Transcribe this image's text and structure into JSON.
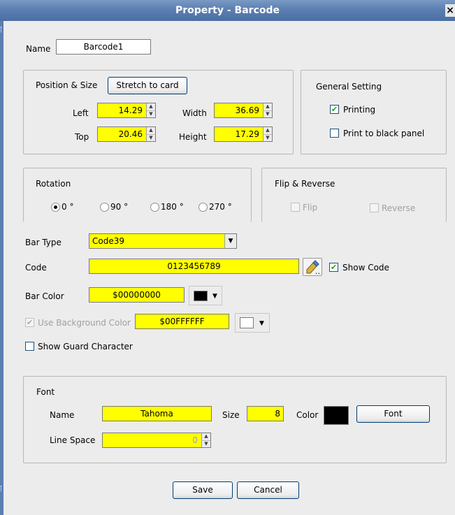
{
  "window": {
    "title": "Property - Barcode",
    "close_glyph": "×"
  },
  "name_field": {
    "label": "Name",
    "value": "Barcode1"
  },
  "position_size": {
    "group_label": "Position & Size",
    "stretch_button": "Stretch to card",
    "left": {
      "label": "Left",
      "value": "14.29"
    },
    "top": {
      "label": "Top",
      "value": "20.46"
    },
    "width": {
      "label": "Width",
      "value": "36.69"
    },
    "height": {
      "label": "Height",
      "value": "17.29"
    }
  },
  "general_setting": {
    "group_label": "General Setting",
    "printing": {
      "label": "Printing",
      "checked": true
    },
    "print_black": {
      "label": "Print to black panel",
      "checked": false
    }
  },
  "rotation": {
    "group_label": "Rotation",
    "options": [
      "0 °",
      "90 °",
      "180 °",
      "270 °"
    ],
    "selected": "0 °"
  },
  "flip_reverse": {
    "group_label": "Flip & Reverse",
    "flip": "Flip",
    "reverse": "Reverse"
  },
  "bar_type": {
    "label": "Bar Type",
    "value": "Code39"
  },
  "code": {
    "label": "Code",
    "value": "0123456789",
    "more_glyph": "..",
    "show_code": "Show Code"
  },
  "bar_color": {
    "label": "Bar Color",
    "value": "$00000000",
    "swatch": "#000000"
  },
  "background": {
    "label": "Use Background Color",
    "value": "$00FFFFFF",
    "swatch": "#ffffff"
  },
  "guard": {
    "label": "Show Guard Character"
  },
  "font": {
    "group_label": "Font",
    "name_label": "Name",
    "name_value": "Tahoma",
    "size_label": "Size",
    "size_value": "8",
    "color_label": "Color",
    "color_swatch": "#000000",
    "font_button": "Font",
    "line_space_label": "Line Space",
    "line_space_value": "0"
  },
  "actions": {
    "save": "Save",
    "cancel": "Cancel"
  },
  "icons": {
    "check": "✔",
    "dropdown": "▼",
    "spin_up": "▲",
    "spin_down": "▼"
  }
}
